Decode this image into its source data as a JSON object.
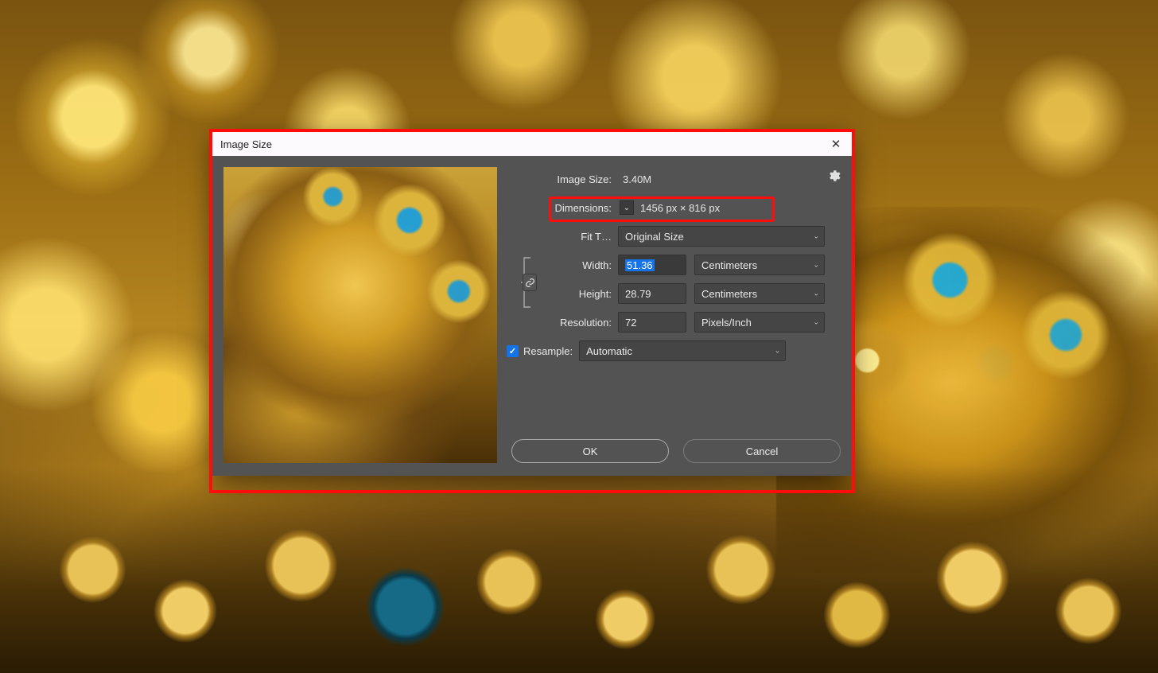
{
  "dialog": {
    "title": "Image Size",
    "imageSizeLabel": "Image Size:",
    "imageSizeValue": "3.40M",
    "dimensionsLabel": "Dimensions:",
    "dimensionsValue": "1456 px  ×  816 px",
    "fitToLabel": "Fit T…",
    "fitToValue": "Original Size",
    "widthLabel": "Width:",
    "widthValue": "51.36",
    "widthUnit": "Centimeters",
    "heightLabel": "Height:",
    "heightValue": "28.79",
    "heightUnit": "Centimeters",
    "resolutionLabel": "Resolution:",
    "resolutionValue": "72",
    "resolutionUnit": "Pixels/Inch",
    "resampleLabel": "Resample:",
    "resampleValue": "Automatic",
    "okLabel": "OK",
    "cancelLabel": "Cancel"
  }
}
